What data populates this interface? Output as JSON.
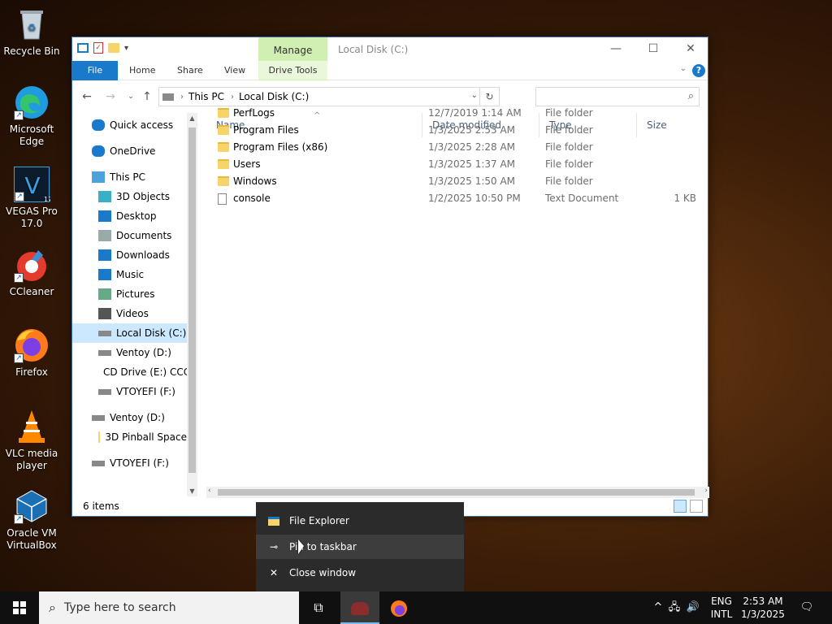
{
  "desktop": {
    "icons": [
      {
        "label": "Recycle Bin"
      },
      {
        "label": "Microsoft Edge"
      },
      {
        "label": "VEGAS Pro 17.0"
      },
      {
        "label": "CCleaner"
      },
      {
        "label": "Firefox"
      },
      {
        "label": "VLC media player"
      },
      {
        "label": "Oracle VM VirtualBox"
      }
    ]
  },
  "window": {
    "title": "Local Disk (C:)",
    "manage_tab": "Manage",
    "ribbon_tabs": [
      "File",
      "Home",
      "Share",
      "View"
    ],
    "drive_tools_tab": "Drive Tools",
    "help_glyph": "?",
    "breadcrumb": [
      "This PC",
      "Local Disk (C:)"
    ],
    "search_placeholder": "",
    "nav_pane": [
      {
        "label": "Quick access",
        "icon": "star-icon"
      },
      {
        "label": "OneDrive",
        "icon": "cloud-icon"
      },
      {
        "label": "This PC",
        "icon": "computer-icon"
      },
      {
        "label": "3D Objects",
        "icon": "cube-icon"
      },
      {
        "label": "Desktop",
        "icon": "desktop-icon"
      },
      {
        "label": "Documents",
        "icon": "document-icon"
      },
      {
        "label": "Downloads",
        "icon": "download-icon"
      },
      {
        "label": "Music",
        "icon": "music-icon"
      },
      {
        "label": "Pictures",
        "icon": "pictures-icon"
      },
      {
        "label": "Videos",
        "icon": "video-icon"
      },
      {
        "label": "Local Disk (C:)",
        "icon": "drive-icon",
        "selected": true
      },
      {
        "label": "Ventoy (D:)",
        "icon": "drive-icon"
      },
      {
        "label": "CD Drive (E:) CCC",
        "icon": "cd-drive-icon"
      },
      {
        "label": "VTOYEFI (F:)",
        "icon": "drive-icon"
      },
      {
        "label": "Ventoy (D:)",
        "icon": "drive-icon"
      },
      {
        "label": "3D Pinball Space",
        "icon": "folder-icon"
      },
      {
        "label": "VTOYEFI (F:)",
        "icon": "drive-icon"
      }
    ],
    "columns": [
      "Name",
      "Date modified",
      "Type",
      "Size"
    ],
    "files": [
      {
        "name": "PerfLogs",
        "date": "12/7/2019 1:14 AM",
        "type": "File folder",
        "size": "",
        "kind": "folder"
      },
      {
        "name": "Program Files",
        "date": "1/3/2025 2:53 AM",
        "type": "File folder",
        "size": "",
        "kind": "folder"
      },
      {
        "name": "Program Files (x86)",
        "date": "1/3/2025 2:28 AM",
        "type": "File folder",
        "size": "",
        "kind": "folder"
      },
      {
        "name": "Users",
        "date": "1/3/2025 1:37 AM",
        "type": "File folder",
        "size": "",
        "kind": "folder"
      },
      {
        "name": "Windows",
        "date": "1/3/2025 1:50 AM",
        "type": "File folder",
        "size": "",
        "kind": "folder"
      },
      {
        "name": "console",
        "date": "1/2/2025 10:50 PM",
        "type": "Text Document",
        "size": "1 KB",
        "kind": "text"
      }
    ],
    "status": "6 items"
  },
  "jump_list": {
    "items": [
      {
        "label": "File Explorer",
        "icon": "file-explorer-icon"
      },
      {
        "label": "Pin to taskbar",
        "icon": "pin-icon"
      },
      {
        "label": "Close window",
        "icon": "close-icon"
      }
    ]
  },
  "taskbar": {
    "search_placeholder": "Type here to search",
    "lang_top": "ENG",
    "lang_bottom": "INTL",
    "time": "2:53 AM",
    "date": "1/3/2025"
  }
}
